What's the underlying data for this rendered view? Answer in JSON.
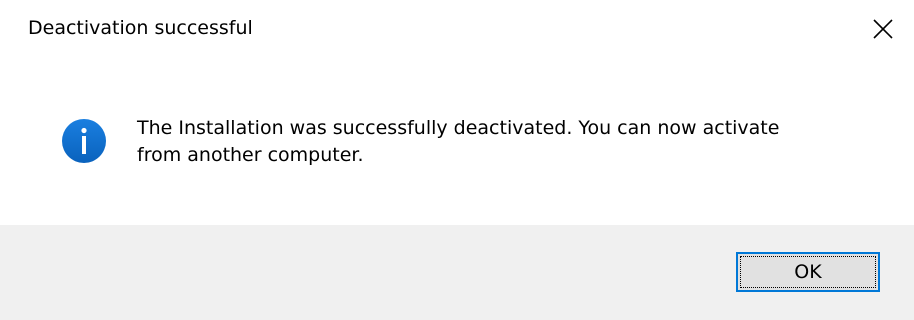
{
  "dialog": {
    "title": "Deactivation successful",
    "message_line1": "The Installation was successfully deactivated. You can now activate",
    "message_line2": "from another computer.",
    "icon": "information-icon",
    "ok_label": "OK"
  },
  "colors": {
    "icon_blue": "#0a6ecd",
    "footer_bg": "#f0f0f0",
    "button_border": "#0078d7",
    "button_bg": "#e1e1e1"
  }
}
